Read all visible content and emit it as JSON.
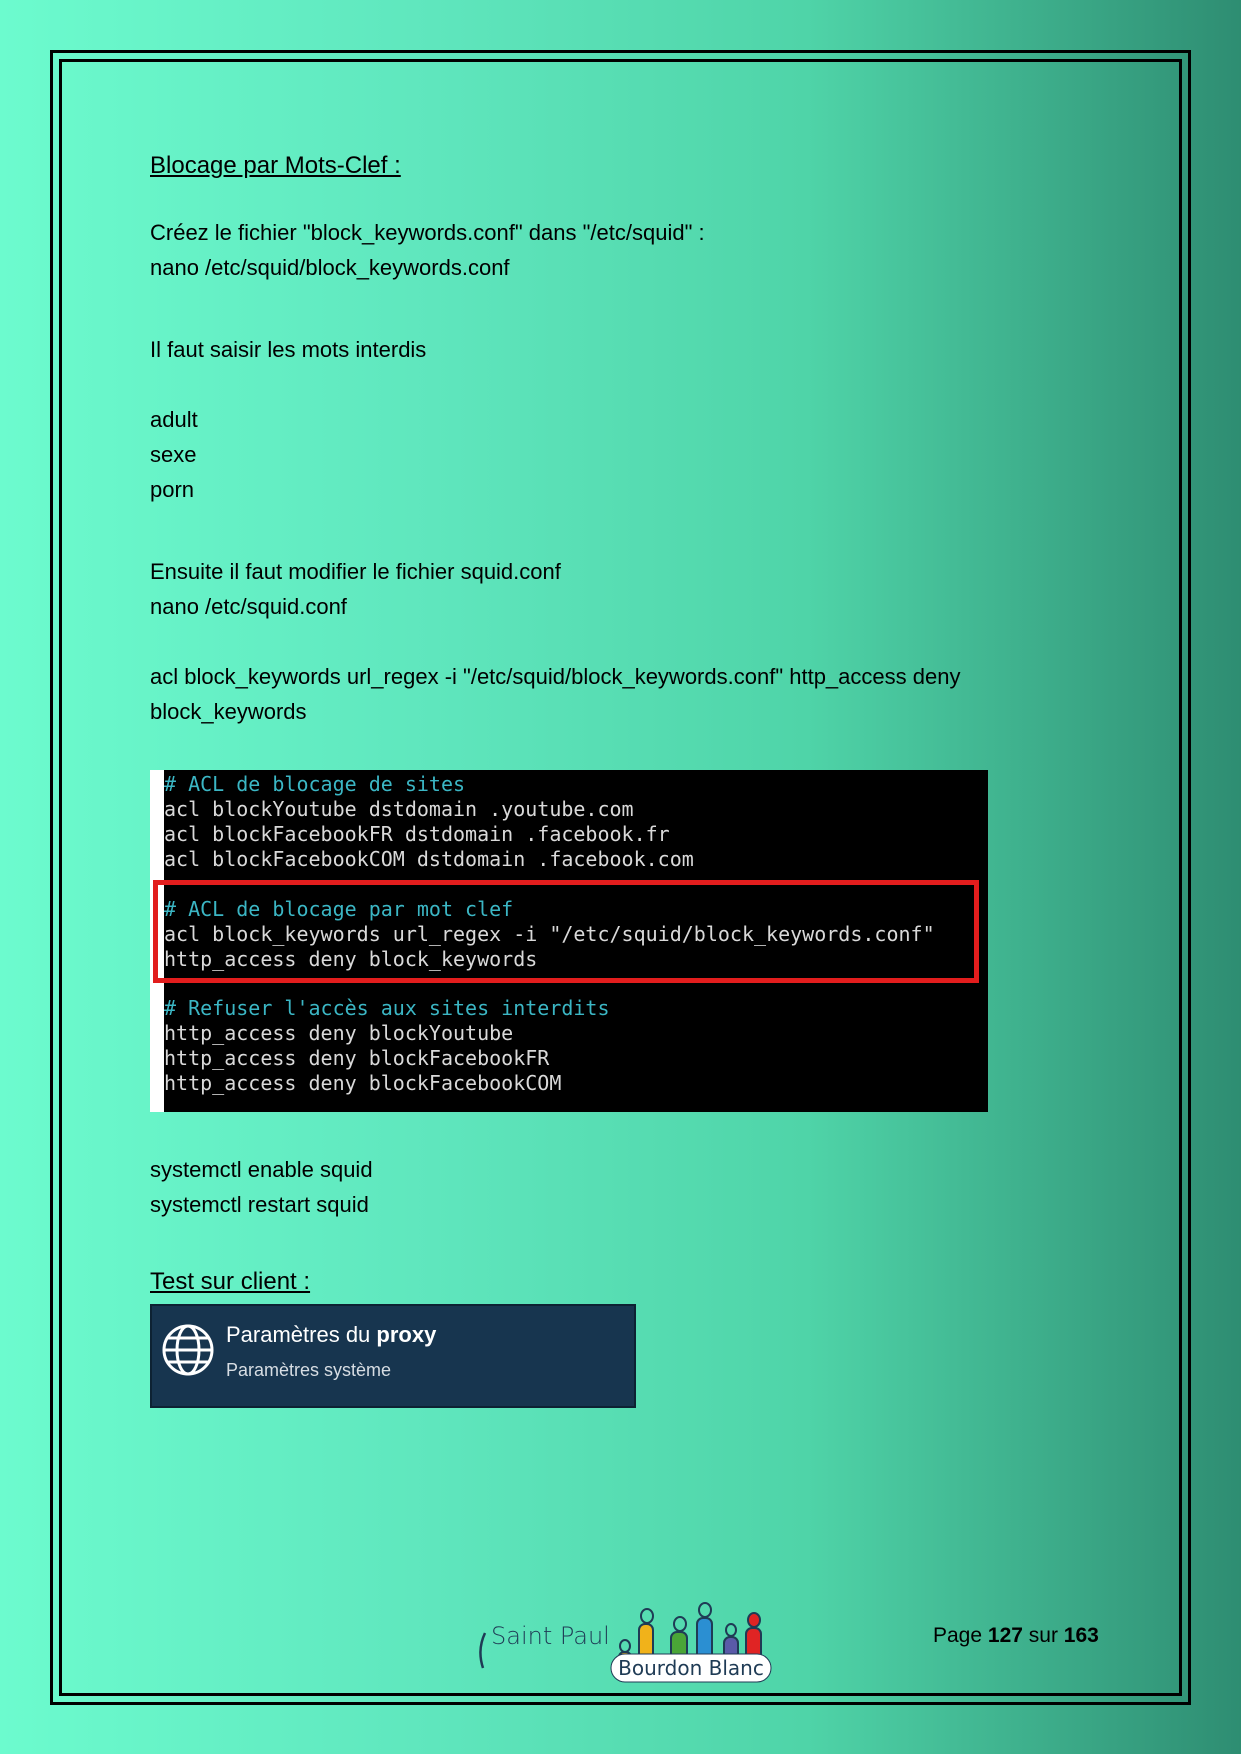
{
  "section1": {
    "title": "Blocage par Mots-Clef :",
    "intro": "Créez le fichier \"block_keywords.conf\" dans \"/etc/squid\" :",
    "cmd_nano_keywords": "nano /etc/squid/block_keywords.conf",
    "instruction": "Il faut saisir les mots interdis",
    "keywords": [
      "adult",
      "sexe",
      "porn"
    ],
    "modify_text": "Ensuite il faut modifier le fichier squid.conf",
    "cmd_nano_conf": "nano /etc/squid.conf",
    "acl_line1": "acl block_keywords url_regex -i \"/etc/squid/block_keywords.conf\" http_access deny",
    "acl_line2": "block_keywords"
  },
  "terminal": {
    "lines": [
      {
        "text": "# ACL de blocage de sites",
        "kind": "comment"
      },
      {
        "text": "acl blockYoutube dstdomain .youtube.com",
        "kind": "code"
      },
      {
        "text": "acl blockFacebookFR dstdomain .facebook.fr",
        "kind": "code"
      },
      {
        "text": "acl blockFacebookCOM dstdomain .facebook.com",
        "kind": "code"
      },
      {
        "text": "",
        "kind": "blank"
      },
      {
        "text": "# ACL de blocage par mot clef",
        "kind": "comment"
      },
      {
        "text": "acl block_keywords url_regex -i \"/etc/squid/block_keywords.conf\"",
        "kind": "code"
      },
      {
        "text": "http_access deny block_keywords",
        "kind": "code"
      },
      {
        "text": "",
        "kind": "blank"
      },
      {
        "text": "# Refuser l'accès aux sites interdits",
        "kind": "comment"
      },
      {
        "text": "http_access deny blockYoutube",
        "kind": "code"
      },
      {
        "text": "http_access deny blockFacebookFR",
        "kind": "code"
      },
      {
        "text": "http_access deny blockFacebookCOM",
        "kind": "code"
      }
    ],
    "highlight_color": "#e21d1d"
  },
  "commands": {
    "enable": "systemctl enable squid",
    "restart": "systemctl restart squid"
  },
  "section2": {
    "title": "Test sur client :"
  },
  "proxy_card": {
    "icon": "globe-icon",
    "title_prefix": "Paramètres du ",
    "title_bold": "proxy",
    "subtitle": "Paramètres système"
  },
  "footer": {
    "logo_text": "Saint Paul",
    "logo_caption": "Bourdon Blanc",
    "page_prefix": "Page ",
    "page_current": "127",
    "page_sep": " sur ",
    "page_total": "163"
  }
}
